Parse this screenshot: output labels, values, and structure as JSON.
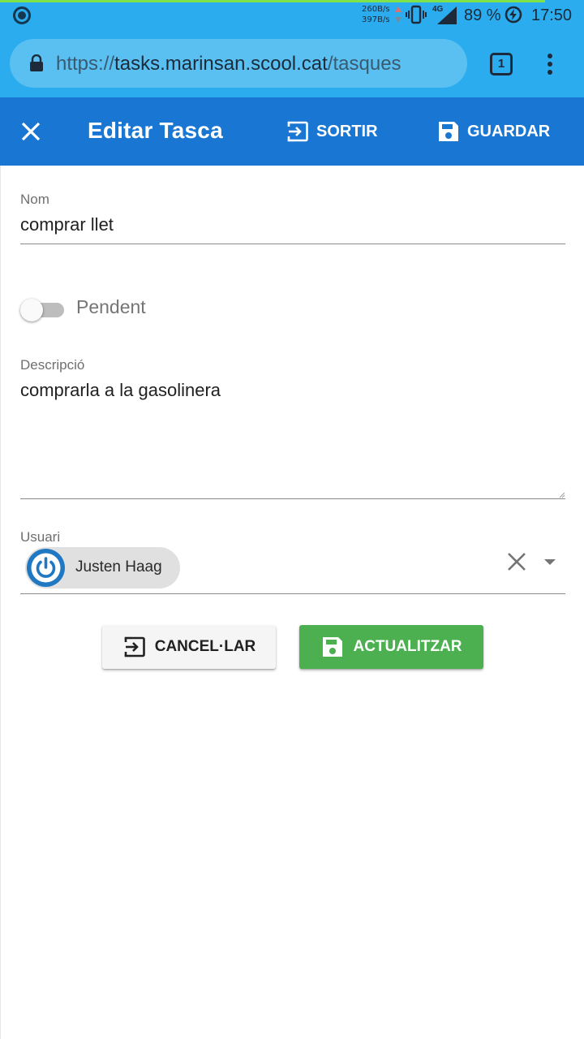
{
  "status_bar": {
    "net_down": "260B/s",
    "net_up": "397B/s",
    "network": "4G",
    "battery": "89 %",
    "time": "17:50"
  },
  "browser": {
    "url_scheme": "https://",
    "url_host": "tasks.marinsan.scool.cat",
    "url_path": "/tasques",
    "tab_count": "1"
  },
  "app_bar": {
    "title": "Editar Tasca",
    "exit_label": "SORTIR",
    "save_label": "GUARDAR"
  },
  "form": {
    "name_label": "Nom",
    "name_value": "comprar llet",
    "status_label": "Pendent",
    "completed": false,
    "description_label": "Descripció",
    "description_value": "comprarla a la gasolinera",
    "user_label": "Usuari",
    "user_name": "Justen Haag",
    "cancel_label": "CANCEL·LAR",
    "update_label": "ACTUALITZAR"
  },
  "colors": {
    "status_bar": "#2bacee",
    "app_bar": "#1976d2",
    "update_button": "#4caf50",
    "avatar": "#1f78c1"
  }
}
